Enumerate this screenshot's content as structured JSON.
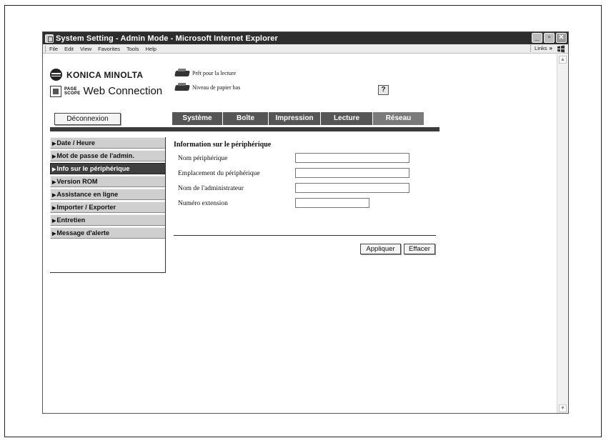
{
  "window": {
    "title": "System Setting - Admin Mode - Microsoft Internet Explorer",
    "controls": {
      "minimize": "_",
      "maximize": "▫",
      "close": "✕"
    }
  },
  "menubar": {
    "items": [
      "File",
      "Edit",
      "View",
      "Favorites",
      "Tools",
      "Help"
    ],
    "links_label": "Links",
    "links_chevron": "»"
  },
  "header": {
    "brand": "KONICA MINOLTA",
    "pagescope_small_1": "PAGE",
    "pagescope_small_2": "SCOPE",
    "pagescope_product": "Web Connection",
    "status_ready": "Prêt pour la lecture",
    "status_paper_low": "Niveau de papier bas",
    "help_label": "?"
  },
  "logout_label": "Déconnexion",
  "tabs": [
    {
      "label": "Système"
    },
    {
      "label": "Boîte"
    },
    {
      "label": "Impression"
    },
    {
      "label": "Lecture"
    },
    {
      "label": "Réseau"
    }
  ],
  "sidebar": {
    "items": [
      {
        "label": "Date / Heure"
      },
      {
        "label": "Mot de passe de l'admin."
      },
      {
        "label": "Info sur le périphérique",
        "active": true
      },
      {
        "label": "Version ROM"
      },
      {
        "label": "Assistance en ligne"
      },
      {
        "label": "Importer / Exporter"
      },
      {
        "label": "Entretien"
      },
      {
        "label": "Message d'alerte"
      }
    ]
  },
  "form": {
    "title": "Information sur le périphérique",
    "fields": [
      {
        "label": "Nom périphérique",
        "value": ""
      },
      {
        "label": "Emplacement du périphérique",
        "value": ""
      },
      {
        "label": "Nom de l'administrateur",
        "value": ""
      },
      {
        "label": "Numéro extension",
        "value": ""
      }
    ],
    "apply_label": "Appliquer",
    "clear_label": "Effacer"
  },
  "scrollbar": {
    "up": "▲",
    "down": "▼"
  },
  "colors": {
    "titlebar": "#2d2d2d",
    "tab_bg": "#555555",
    "dark_bar": "#3b3b3b",
    "sidebar_item": "#cfcfcf",
    "sidebar_active": "#3f3f3f"
  }
}
